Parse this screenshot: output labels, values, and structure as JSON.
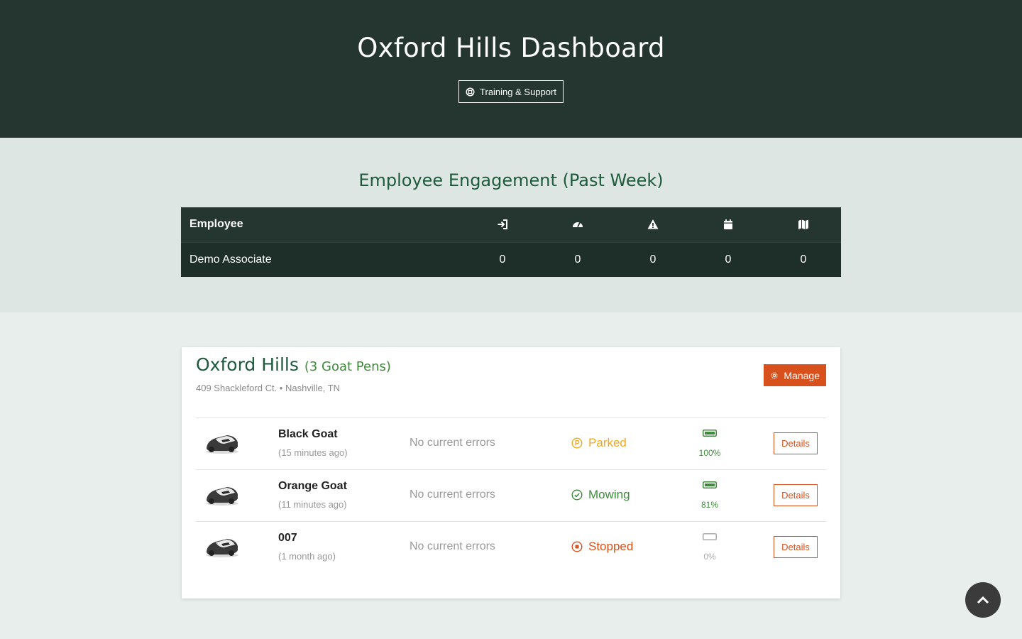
{
  "header": {
    "title": "Oxford Hills Dashboard",
    "support_label": "Training & Support",
    "support_icon": "life-ring-icon"
  },
  "engagement": {
    "title": "Employee Engagement (Past Week)",
    "column_header": "Employee",
    "column_icons": [
      "sign-in-icon",
      "gauge-icon",
      "warning-icon",
      "calendar-icon",
      "map-icon"
    ],
    "rows": [
      {
        "employee": "Demo Associate",
        "values": [
          "0",
          "0",
          "0",
          "0",
          "0"
        ]
      }
    ]
  },
  "site": {
    "name": "Oxford Hills",
    "pens": "(3 Goat Pens)",
    "address": "409 Shackleford Ct. • Nashville, TN",
    "manage_label": "Manage",
    "mowers": [
      {
        "name": "Black Goat",
        "updated": "(15 minutes ago)",
        "errors": "No current errors",
        "status": "Parked",
        "status_color": "#f0a81c",
        "battery": "100%",
        "battery_level": 1.0,
        "battery_color": "#3d8a3a",
        "details_label": "Details"
      },
      {
        "name": "Orange Goat",
        "updated": "(11 minutes ago)",
        "errors": "No current errors",
        "status": "Mowing",
        "status_color": "#3d8a3a",
        "battery": "81%",
        "battery_level": 0.81,
        "battery_color": "#3d8a3a",
        "details_label": "Details"
      },
      {
        "name": "007",
        "updated": "(1 month ago)",
        "errors": "No current errors",
        "status": "Stopped",
        "status_color": "#d8501c",
        "battery": "0%",
        "battery_level": 0,
        "battery_color": "#aaaaaa",
        "details_label": "Details"
      }
    ]
  },
  "colors": {
    "header_bg": "#253530",
    "accent_green": "#1e5a3c",
    "accent_orange": "#d8501c"
  }
}
